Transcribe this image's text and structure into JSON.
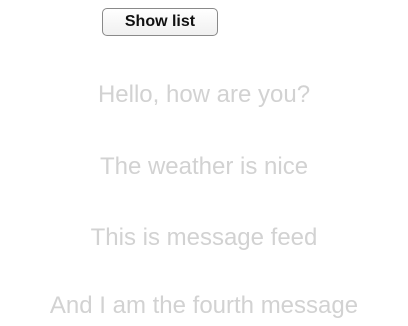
{
  "toolbar": {
    "show_list_label": "Show list"
  },
  "feed": {
    "messages": [
      "Hello, how are you?",
      "The weather is nice",
      "This is message feed",
      "And I am the fourth message"
    ]
  }
}
